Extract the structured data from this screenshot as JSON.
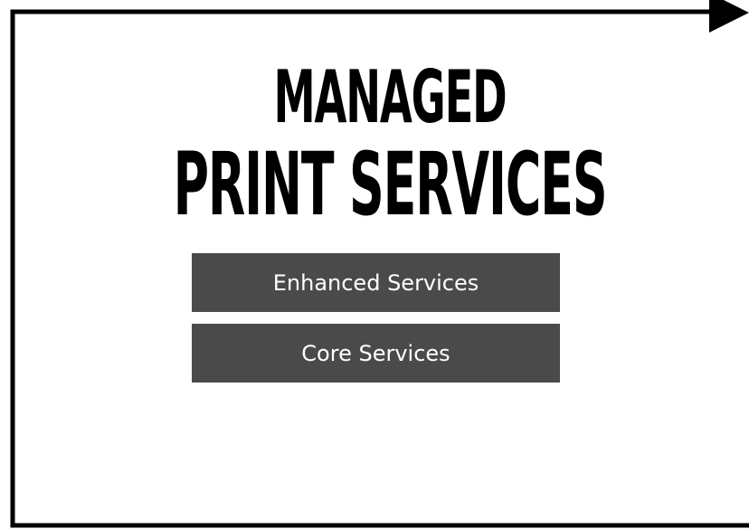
{
  "title": {
    "line1": "MANAGED",
    "line2": "PRINT SERVICES"
  },
  "services": [
    {
      "label": "Enhanced Services"
    },
    {
      "label": "Core Services"
    }
  ],
  "colors": {
    "frame": "#000000",
    "box_fill": "#4a4a4a",
    "box_text": "#ffffff",
    "background": "#ffffff"
  }
}
